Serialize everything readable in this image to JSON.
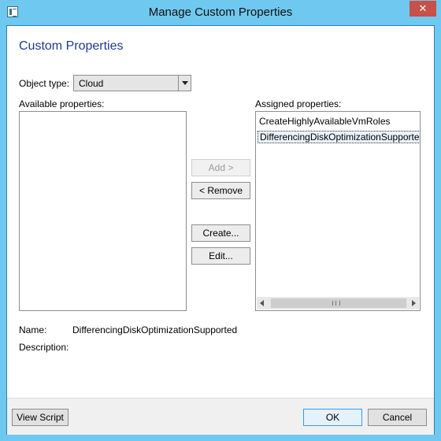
{
  "window": {
    "title": "Manage Custom Properties",
    "close_label": "✕"
  },
  "heading": "Custom Properties",
  "object_type": {
    "label": "Object type:",
    "value": "Cloud"
  },
  "available": {
    "label": "Available properties:",
    "items": []
  },
  "assigned": {
    "label": "Assigned properties:",
    "items": [
      "CreateHighlyAvailableVmRoles",
      "DifferencingDiskOptimizationSupported"
    ],
    "selected_index": 1
  },
  "actions": {
    "add": "Add >",
    "remove": "< Remove",
    "create": "Create...",
    "edit": "Edit..."
  },
  "details": {
    "name_label": "Name:",
    "name_value": "DifferencingDiskOptimizationSupported",
    "description_label": "Description:",
    "description_value": ""
  },
  "footer": {
    "view_script": "View Script",
    "ok": "OK",
    "cancel": "Cancel"
  },
  "icons": {
    "app": "window-app-icon",
    "close": "close-icon",
    "dropdown": "chevron-down-icon"
  }
}
